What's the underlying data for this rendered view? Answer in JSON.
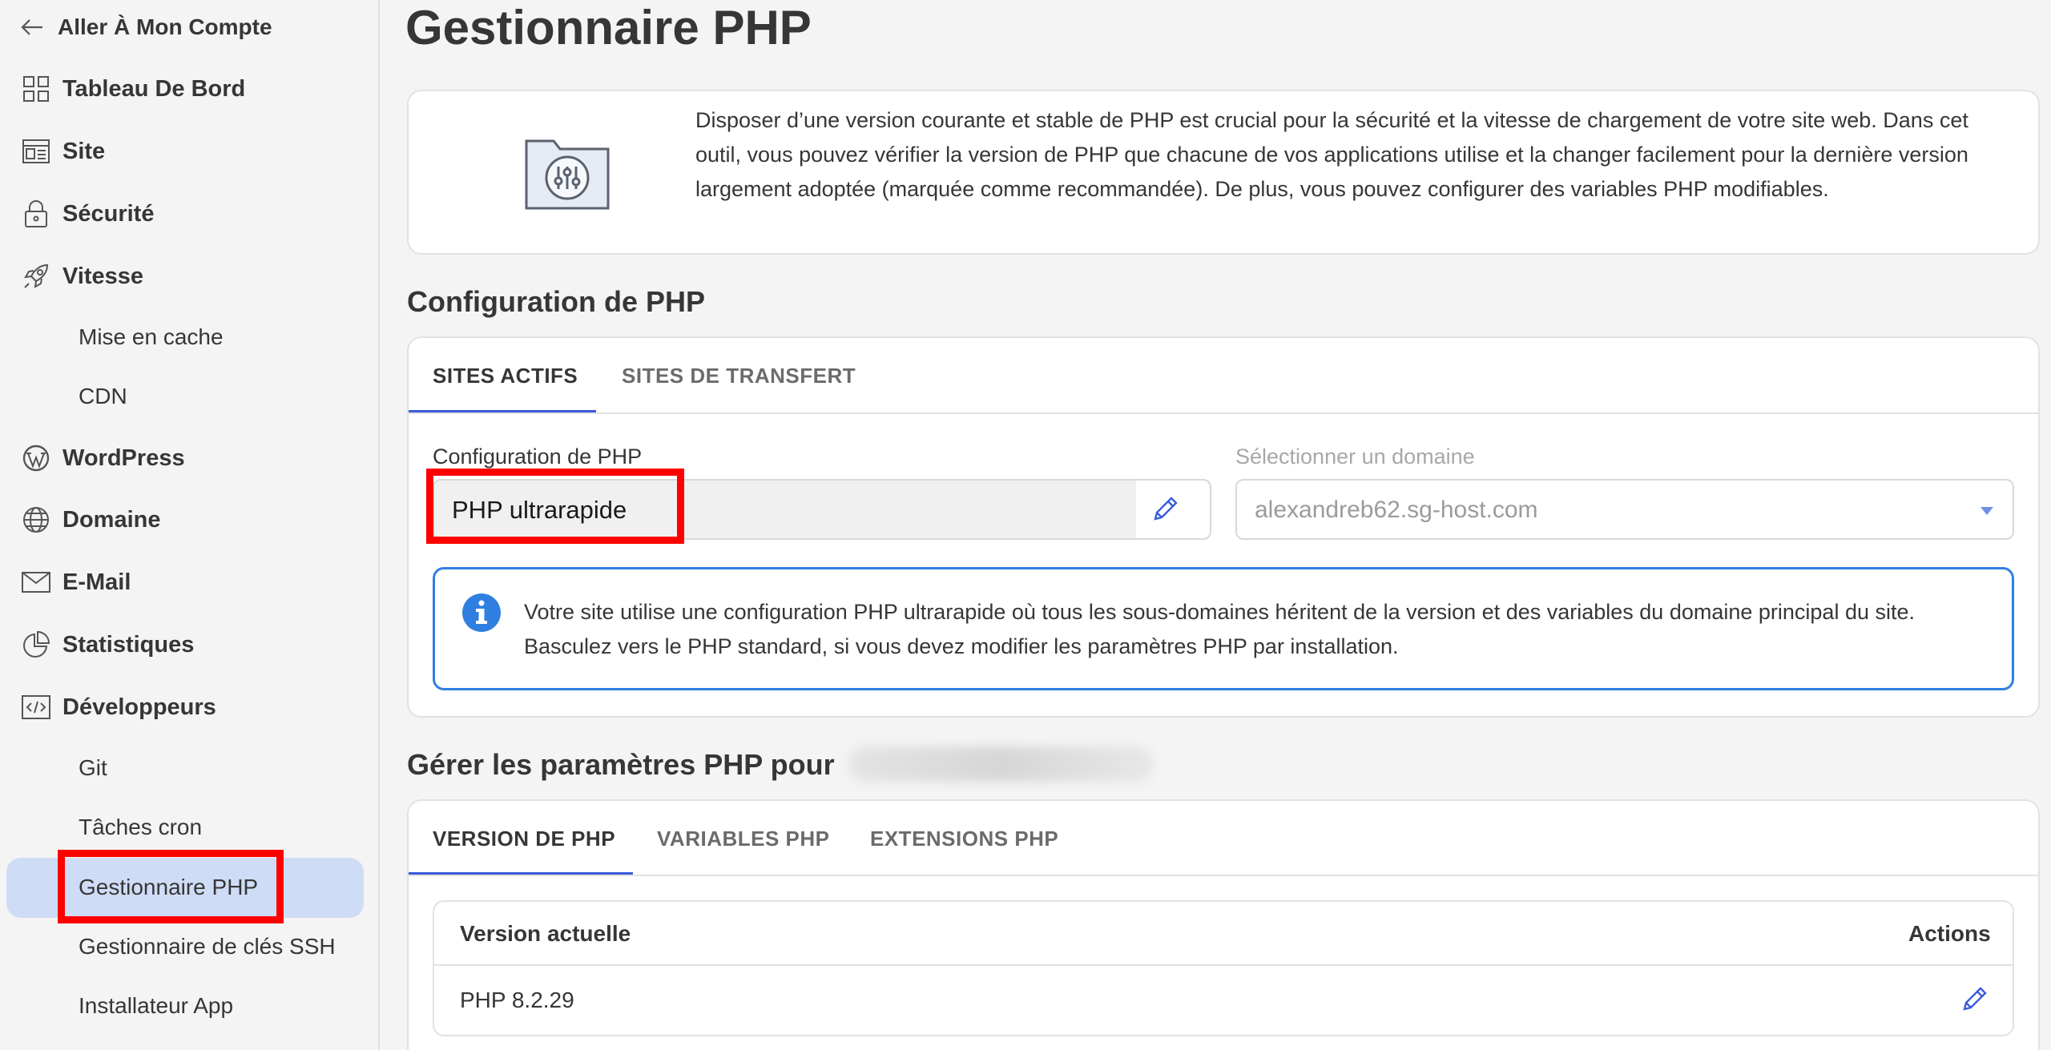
{
  "sidebar": {
    "back_label": "Aller À Mon Compte",
    "items": [
      {
        "label": "Tableau De Bord",
        "icon": "dashboard-grid-icon"
      },
      {
        "label": "Site",
        "icon": "site-layout-icon"
      },
      {
        "label": "Sécurité",
        "icon": "lock-icon"
      },
      {
        "label": "Vitesse",
        "icon": "rocket-icon"
      },
      {
        "label": "Mise en cache"
      },
      {
        "label": "CDN"
      },
      {
        "label": "WordPress",
        "icon": "wordpress-icon"
      },
      {
        "label": "Domaine",
        "icon": "globe-icon"
      },
      {
        "label": "E-Mail",
        "icon": "mail-icon"
      },
      {
        "label": "Statistiques",
        "icon": "pie-chart-icon"
      },
      {
        "label": "Développeurs",
        "icon": "code-icon"
      },
      {
        "label": "Git"
      },
      {
        "label": "Tâches cron"
      },
      {
        "label": "Gestionnaire PHP",
        "active": true
      },
      {
        "label": "Gestionnaire de clés SSH"
      },
      {
        "label": "Installateur App"
      }
    ]
  },
  "page": {
    "title": "Gestionnaire PHP",
    "intro": "Disposer d’une version courante et stable de PHP est crucial pour la sécurité et la vitesse de chargement de votre site web. Dans cet outil, vous pouvez vérifier la version de PHP que chacune de vos applications utilise et la changer facilement pour la dernière version largement adoptée (marquée comme recommandée). De plus, vous pouvez configurer des variables PHP modifiables."
  },
  "config": {
    "section_title": "Configuration de PHP",
    "tabs": [
      "SITES ACTIFS",
      "SITES DE TRANSFERT"
    ],
    "field_label": "Configuration de PHP",
    "field_value": "PHP ultrarapide",
    "domain_label": "Sélectionner un domaine",
    "domain_value": "alexandreb62.sg-host.com",
    "info": "Votre site utilise une configuration PHP ultrarapide où tous les sous-domaines héritent de la version et des variables du domaine principal du site. Basculez vers le PHP standard, si vous devez modifier les paramètres PHP par installation."
  },
  "manage": {
    "section_title": "Gérer les paramètres PHP pour",
    "tabs": [
      "VERSION DE PHP",
      "VARIABLES PHP",
      "EXTENSIONS PHP"
    ],
    "table": {
      "headers": [
        "Version actuelle",
        "Actions"
      ],
      "rows": [
        [
          "PHP 8.2.29"
        ]
      ]
    }
  },
  "colors": {
    "accent": "#3b5bdb",
    "info_border": "#2f7fe0",
    "highlight": "#ff0000",
    "active_nav": "#cfdcf6"
  }
}
